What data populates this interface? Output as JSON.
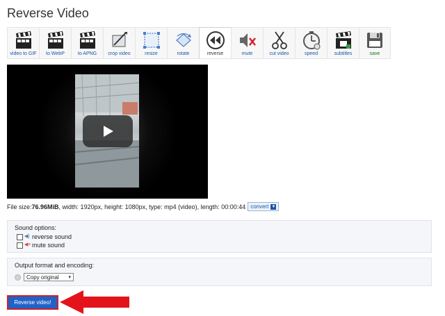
{
  "page": {
    "title": "Reverse Video"
  },
  "toolbar": {
    "items": [
      {
        "label": "video to GIF",
        "icon": "clapperboard-icon"
      },
      {
        "label": "to WebP",
        "icon": "clapperboard-icon"
      },
      {
        "label": "to APNG",
        "icon": "clapperboard-icon"
      },
      {
        "label": "crop video",
        "icon": "crop-icon"
      },
      {
        "label": "resize",
        "icon": "resize-icon"
      },
      {
        "label": "rotate",
        "icon": "rotate-icon"
      },
      {
        "label": "reverse",
        "icon": "rewind-icon"
      },
      {
        "label": "mute",
        "icon": "mute-icon"
      },
      {
        "label": "cut video",
        "icon": "scissors-icon"
      },
      {
        "label": "speed",
        "icon": "stopwatch-icon"
      },
      {
        "label": "subtitles",
        "icon": "subtitles-icon"
      },
      {
        "label": "save",
        "icon": "floppy-disk-icon"
      }
    ],
    "active": "reverse"
  },
  "fileinfo": {
    "prefix": "File size: ",
    "size": "76.96MiB",
    "details": ", width: 1920px, height: 1080px, type: mp4 (video), length: 00:00:44",
    "convert_label": "convert"
  },
  "sound_options": {
    "title": "Sound options:",
    "reverse_label": "reverse sound",
    "mute_label": "mute sound"
  },
  "output": {
    "title": "Output format and encoding:",
    "selected": "Copy original"
  },
  "submit_label": "Reverse video!",
  "colors": {
    "accent": "#1f63c8",
    "arrow": "#e3131b",
    "link": "#1a55a8"
  }
}
